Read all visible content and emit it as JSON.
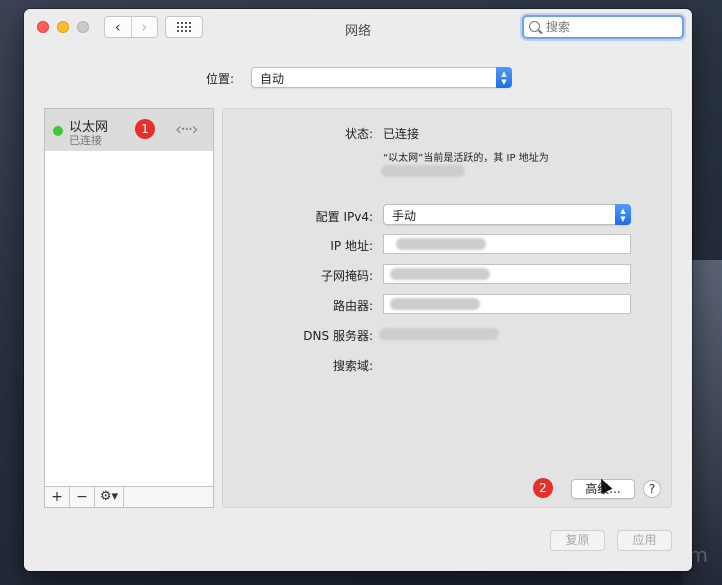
{
  "window": {
    "title": "网络"
  },
  "toolbar": {
    "search_placeholder": "搜索"
  },
  "location": {
    "label": "位置:",
    "value": "自动"
  },
  "sidebar": {
    "services": [
      {
        "name": "以太网",
        "status": "已连接",
        "status_color": "#3ec83e"
      }
    ],
    "add": "+",
    "remove": "−",
    "actions": "⚙▾"
  },
  "badges": {
    "first": "1",
    "second": "2"
  },
  "details": {
    "status_label": "状态:",
    "status_value": "已连接",
    "status_desc": "“以太网”当前是活跃的，其 IP 地址为",
    "config_label": "配置 IPv4:",
    "config_value": "手动",
    "ip_label": "IP 地址:",
    "mask_label": "子网掩码:",
    "router_label": "路由器:",
    "dns_label": "DNS 服务器:",
    "search_domain_label": "搜索域:"
  },
  "buttons": {
    "advanced": "高级...",
    "help": "?",
    "revert": "复原",
    "apply": "应用"
  }
}
